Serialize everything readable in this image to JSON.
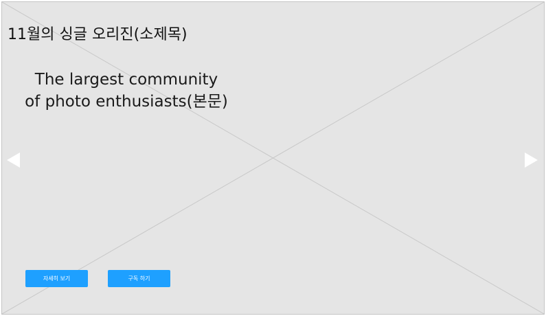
{
  "banner": {
    "subtitle": "11월의 싱글 오리진(소제목)",
    "body_lines": [
      "The largest community",
      "of photo enthusiasts(본문)"
    ],
    "prev_arrow_icon": "triangle-left-icon",
    "next_arrow_icon": "triangle-right-icon",
    "buttons": {
      "detail_label": "자세히 보기",
      "subscribe_label": "구독 하기"
    }
  },
  "colors": {
    "background": "#e5e5e5",
    "border": "#c4c4c4",
    "button": "#1ea0ff",
    "arrow": "#ffffff",
    "cross_line": "#c8c8c8"
  }
}
